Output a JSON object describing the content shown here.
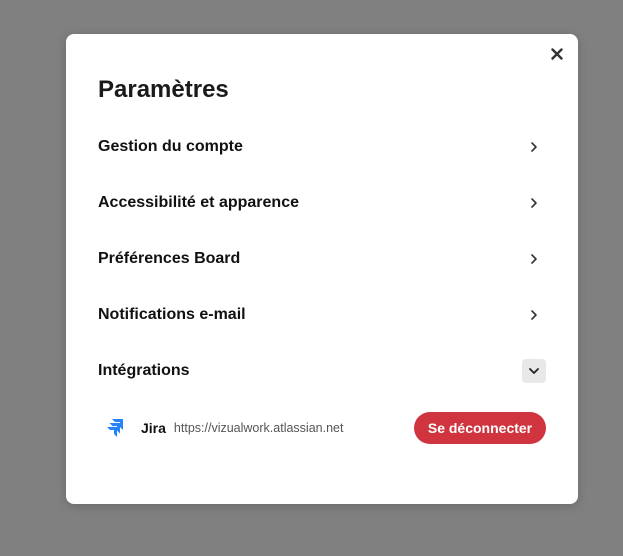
{
  "settings": {
    "title": "Paramètres",
    "items": [
      {
        "label": "Gestion du compte",
        "icon": "chevron-right-icon"
      },
      {
        "label": "Accessibilité et apparence",
        "icon": "chevron-right-icon"
      },
      {
        "label": "Préférences Board",
        "icon": "chevron-right-icon"
      },
      {
        "label": "Notifications e-mail",
        "icon": "chevron-right-icon"
      },
      {
        "label": "Intégrations",
        "icon": "chevron-down-icon",
        "expanded": true
      }
    ],
    "integrations": [
      {
        "name": "Jira",
        "url": "https://vizualwork.atlassian.net",
        "icon": "jira-logo-icon",
        "action_label": "Se déconnecter"
      }
    ]
  },
  "colors": {
    "backdrop": "#808080",
    "modal_bg": "#ffffff",
    "disconnect_button": "#d0353f",
    "jira_blue": "#2684ff"
  }
}
